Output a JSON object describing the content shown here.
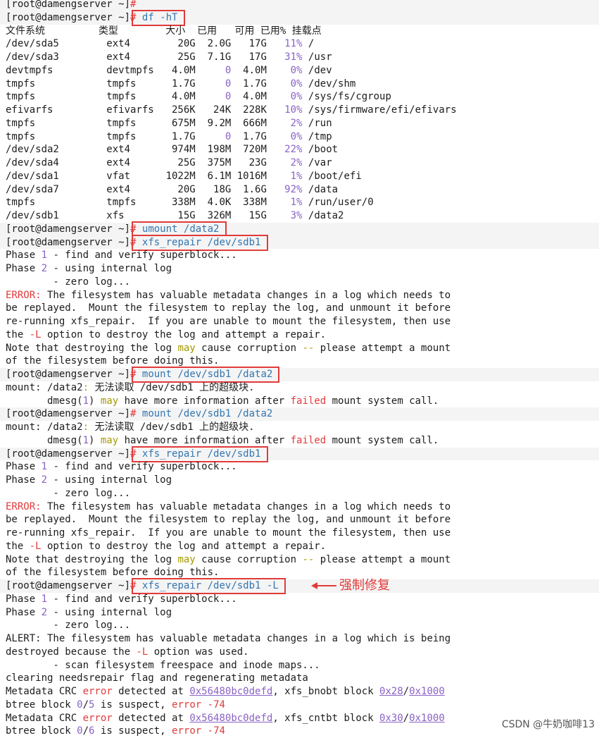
{
  "prompt": "[root@damengserver ~]# ",
  "df": {
    "command": "df -hT",
    "headers": [
      "文件系统",
      "类型",
      "大小",
      "已用",
      "可用",
      "已用%",
      "挂载点"
    ],
    "rows": [
      [
        "/dev/sda5",
        "ext4",
        "20G",
        "2.0G",
        "17G",
        "11%",
        "/"
      ],
      [
        "/dev/sda3",
        "ext4",
        "25G",
        "7.1G",
        "17G",
        "31%",
        "/usr"
      ],
      [
        "devtmpfs",
        "devtmpfs",
        "4.0M",
        "0",
        "4.0M",
        "0%",
        "/dev"
      ],
      [
        "tmpfs",
        "tmpfs",
        "1.7G",
        "0",
        "1.7G",
        "0%",
        "/dev/shm"
      ],
      [
        "tmpfs",
        "tmpfs",
        "4.0M",
        "0",
        "4.0M",
        "0%",
        "/sys/fs/cgroup"
      ],
      [
        "efivarfs",
        "efivarfs",
        "256K",
        "24K",
        "228K",
        "10%",
        "/sys/firmware/efi/efivars"
      ],
      [
        "tmpfs",
        "tmpfs",
        "675M",
        "9.2M",
        "666M",
        "2%",
        "/run"
      ],
      [
        "tmpfs",
        "tmpfs",
        "1.7G",
        "0",
        "1.7G",
        "0%",
        "/tmp"
      ],
      [
        "/dev/sda2",
        "ext4",
        "974M",
        "198M",
        "720M",
        "22%",
        "/boot"
      ],
      [
        "/dev/sda4",
        "ext4",
        "25G",
        "375M",
        "23G",
        "2%",
        "/var"
      ],
      [
        "/dev/sda1",
        "vfat",
        "1022M",
        "6.1M",
        "1016M",
        "1%",
        "/boot/efi"
      ],
      [
        "/dev/sda7",
        "ext4",
        "20G",
        "18G",
        "1.6G",
        "92%",
        "/data"
      ],
      [
        "tmpfs",
        "tmpfs",
        "338M",
        "4.0K",
        "338M",
        "1%",
        "/run/user/0"
      ],
      [
        "/dev/sdb1",
        "xfs",
        "15G",
        "326M",
        "15G",
        "3%",
        "/data2"
      ]
    ]
  },
  "commands": {
    "umount": "umount /data2",
    "xfs_repair": "xfs_repair /dev/sdb1",
    "mount": "mount /dev/sdb1 /data2",
    "xfs_repair_force": "xfs_repair /dev/sdb1 -L"
  },
  "repair_output": {
    "phase1": [
      "Phase ",
      "1",
      " - find and verify superblock..."
    ],
    "phase2": [
      "Phase ",
      "2",
      " - using internal log"
    ],
    "zero_log": "        - zero log...",
    "error_msg": [
      [
        "ERROR:",
        " The filesystem has valuable metadata changes in a log which needs to"
      ],
      [
        "",
        "be replayed.  Mount the filesystem to replay the log, and unmount it before"
      ],
      [
        "",
        "re-running xfs_repair.  If you are unable to mount the filesystem, then use"
      ]
    ],
    "l_line": [
      "the ",
      "-L",
      " option to destroy the log and attempt a repair."
    ],
    "note_line": [
      "Note that destroying the log ",
      "may",
      " cause corruption ",
      "--",
      " please attempt a mount"
    ],
    "last_line": "of the filesystem before doing this."
  },
  "mount_output": {
    "line1": [
      "mount: /data2",
      ":",
      " 无法读取 /dev/sdb1 上的超级块."
    ],
    "line2": [
      "       dmesg(",
      "1",
      ") ",
      "may",
      " have more information after ",
      "failed",
      " mount system call."
    ]
  },
  "force_output": {
    "alert1": "ALERT: The filesystem has valuable metadata changes in a log which is being",
    "alert2": [
      "destroyed because the ",
      "-L",
      " option was used."
    ],
    "scan": "        - scan filesystem freespace and inode maps...",
    "clearing": "clearing needsrepair flag and regenerating metadata",
    "crc1": [
      "Metadata CRC ",
      "error",
      " detected at ",
      "0x56480bc0defd",
      ", xfs_bnobt block ",
      "0x28",
      "/",
      "0x1000"
    ],
    "btree1": [
      "btree block ",
      "0",
      "/",
      "5",
      " is suspect, ",
      "error",
      " -",
      "74"
    ],
    "crc2": [
      "Metadata CRC ",
      "error",
      " detected at ",
      "0x56480bc0defd",
      ", xfs_cntbt block ",
      "0x30",
      "/",
      "0x1000"
    ],
    "btree2": [
      "btree block ",
      "0",
      "/",
      "6",
      " is suspect, ",
      "error",
      " -",
      "74"
    ]
  },
  "annotation": "强制修复",
  "watermark": "CSDN @牛奶咖啡13"
}
